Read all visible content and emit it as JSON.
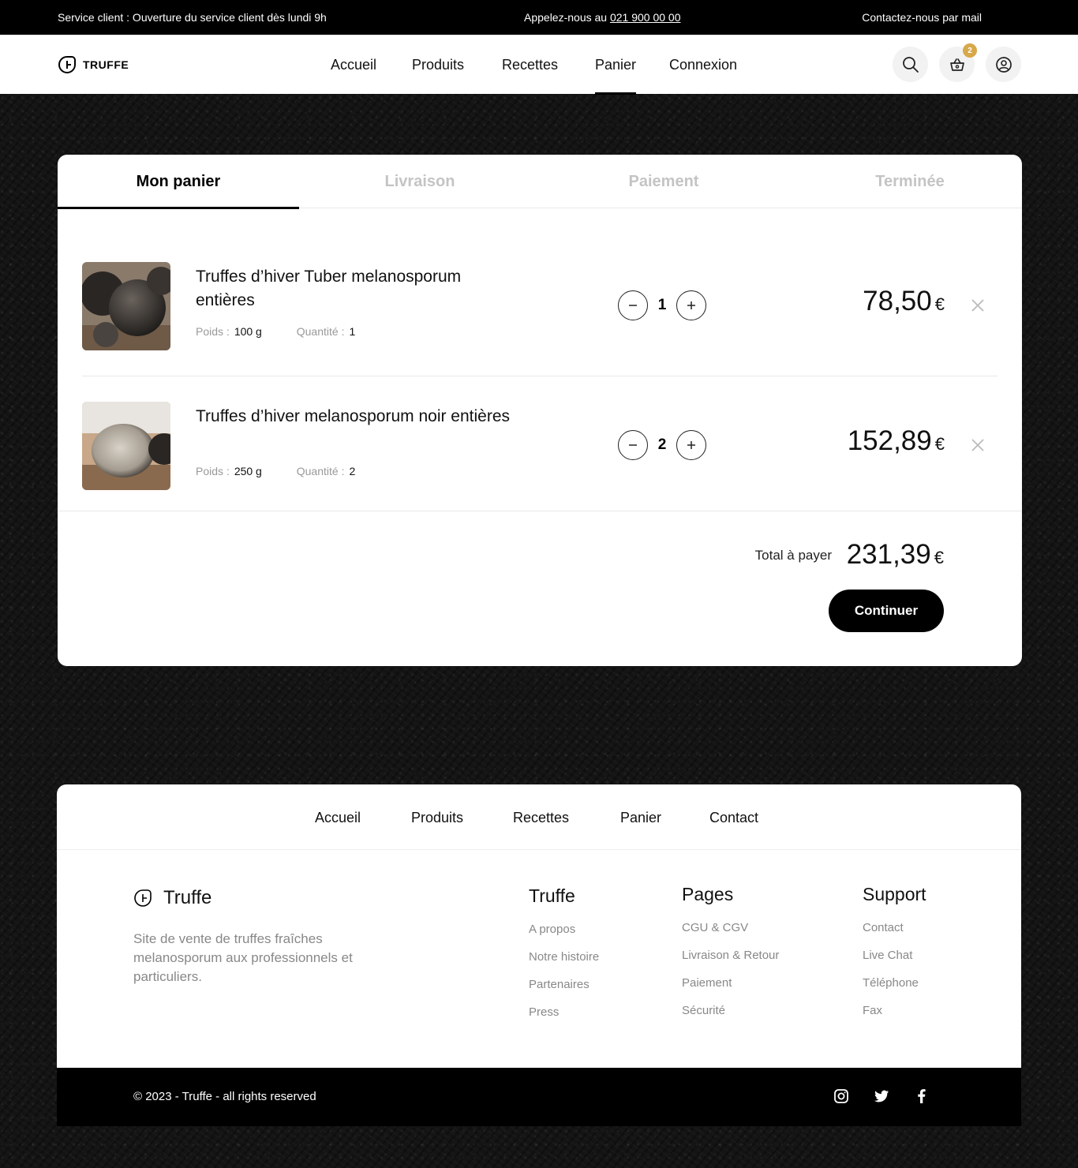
{
  "topbar": {
    "service": "Service client : Ouverture du service client dès lundi 9h",
    "call_prefix": "Appelez-nous au",
    "phone": "021 900 00 00",
    "contact_mail": "Contactez-nous par mail"
  },
  "header": {
    "logo": "TRUFFE",
    "nav": [
      "Accueil",
      "Produits",
      "Recettes",
      "Panier",
      "Connexion"
    ],
    "active_nav": "Panier",
    "cart_count": "2",
    "icons": [
      "search-icon",
      "basket-icon",
      "user-icon"
    ]
  },
  "checkout": {
    "steps": [
      "Mon panier",
      "Livraison",
      "Paiement",
      "Terminée"
    ],
    "active_step": "Mon panier",
    "items": [
      {
        "name": "Truffes d’hiver Tuber melanosporum entières",
        "weight_label": "Poids :",
        "weight": "100 g",
        "qty_label": "Quantité :",
        "qty": "1",
        "price": "78,50",
        "currency": "€"
      },
      {
        "name": "Truffes d’hiver melanosporum noir entières",
        "weight_label": "Poids :",
        "weight": "250 g",
        "qty_label": "Quantité :",
        "qty": "2",
        "price": "152,89",
        "currency": "€"
      }
    ],
    "total_label": "Total à payer",
    "total": "231,39",
    "currency": "€",
    "continue": "Continuer"
  },
  "footer": {
    "nav": [
      "Accueil",
      "Produits",
      "Recettes",
      "Panier",
      "Contact"
    ],
    "brand": "Truffe",
    "description": "Site de vente de truffes fraîches melanosporum aux professionnels et particuliers.",
    "columns": [
      {
        "title": "Truffe",
        "links": [
          "A propos",
          "Notre histoire",
          "Partenaires",
          "Press"
        ]
      },
      {
        "title": "Pages",
        "links": [
          "CGU & CGV",
          "Livraison & Retour",
          "Paiement",
          "Sécurité"
        ]
      },
      {
        "title": "Support",
        "links": [
          "Contact",
          "Live Chat",
          "Téléphone",
          "Fax"
        ]
      }
    ],
    "copyright": "© 2023 - Truffe - all rights reserved",
    "social": [
      "instagram-icon",
      "twitter-icon",
      "facebook-icon"
    ]
  },
  "colors": {
    "accent_badge": "#d7a84a",
    "primary": "#000000",
    "muted_text": "#888888",
    "inactive_step": "#c4c4c4"
  }
}
